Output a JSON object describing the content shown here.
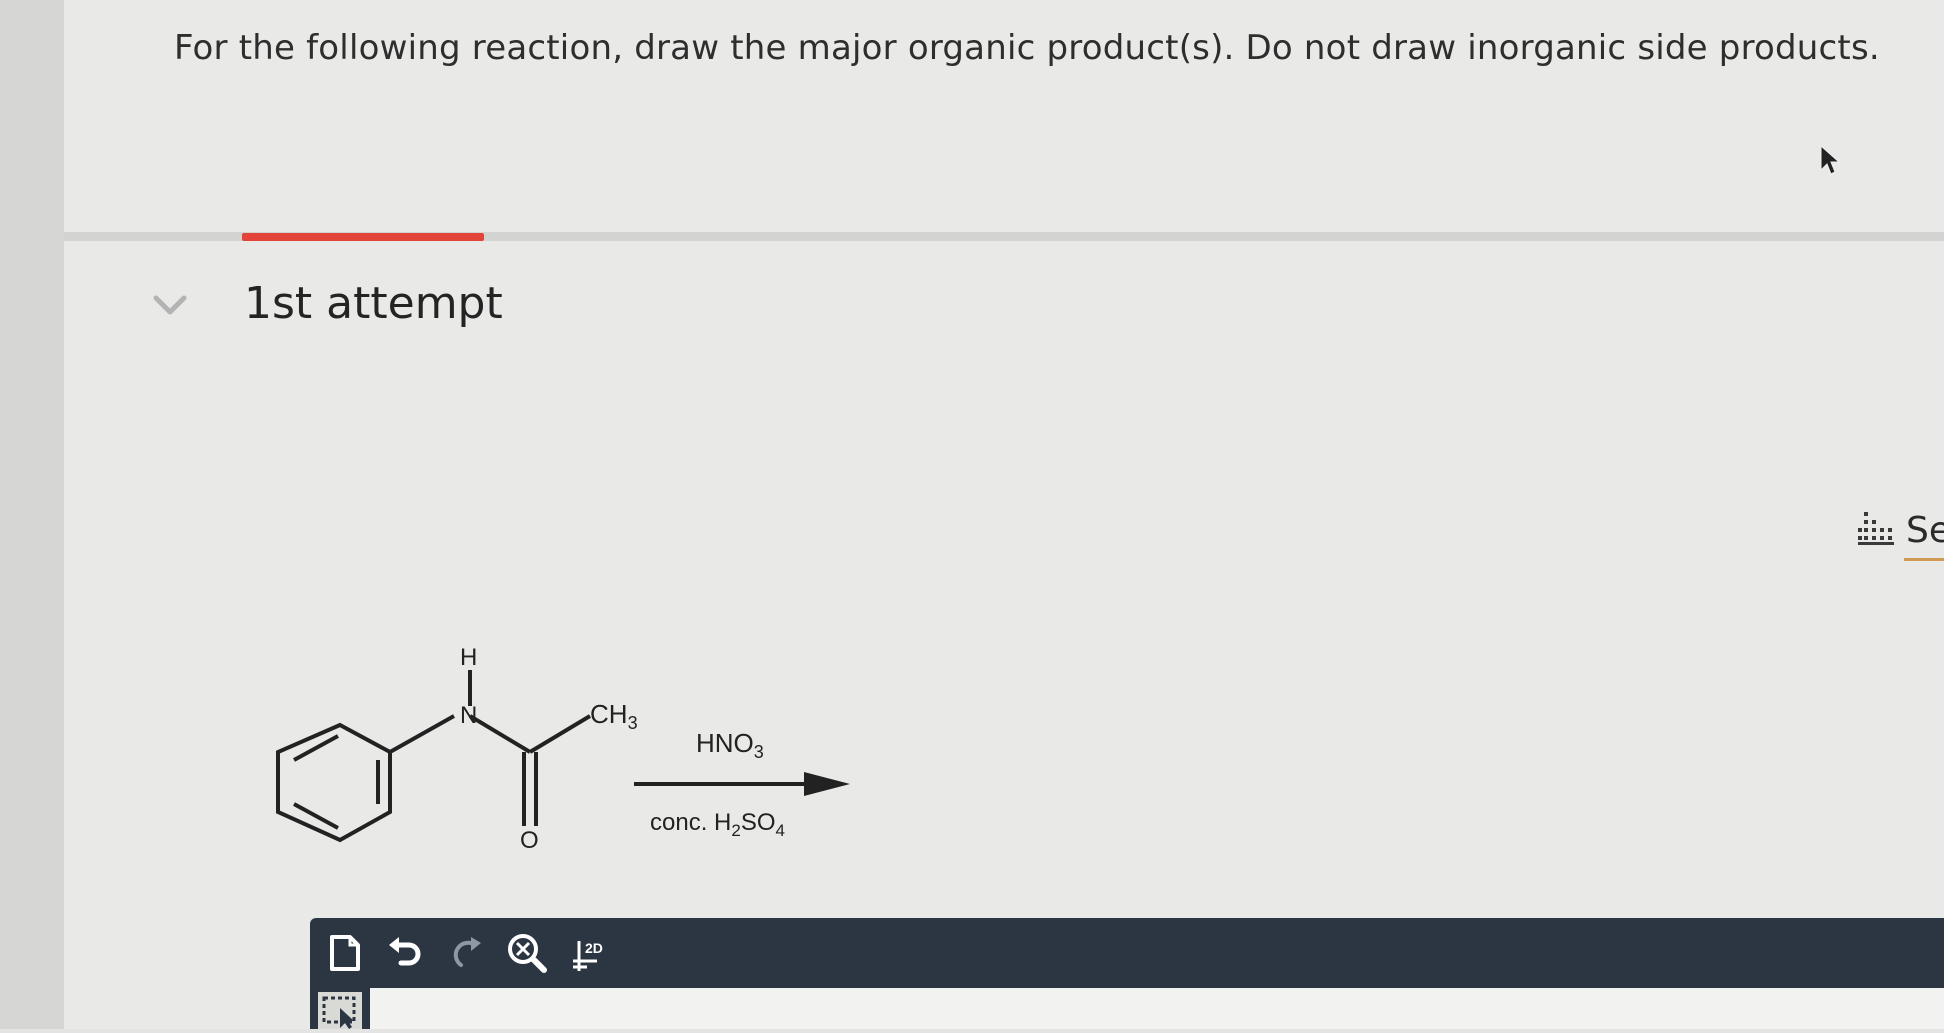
{
  "question": {
    "text": "For the following reaction, draw the major organic product(s). Do not draw inorganic side products."
  },
  "attempt": {
    "title": "1st attempt",
    "progress_color": "#e3443a"
  },
  "reaction": {
    "reactant_labels": {
      "h": "H",
      "n": "N",
      "ch3": "CH",
      "ch3_sub": "3",
      "o": "O"
    },
    "reagent_top": {
      "text": "HNO",
      "sub": "3"
    },
    "reagent_bottom": {
      "prefix": "conc. H",
      "sub1": "2",
      "mid": "SO",
      "sub2": "4"
    }
  },
  "side_tool": {
    "label": "Se",
    "icon": "data-table-icon"
  },
  "toolbar": {
    "buttons": [
      {
        "name": "new-document-icon"
      },
      {
        "name": "undo-icon"
      },
      {
        "name": "redo-icon"
      },
      {
        "name": "zoom-reset-icon"
      },
      {
        "name": "clean-2d-icon",
        "label": "2D"
      }
    ],
    "background": "#2c3643"
  }
}
